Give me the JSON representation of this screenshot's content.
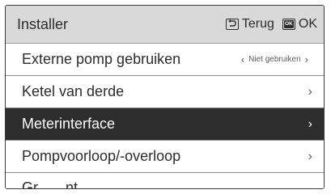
{
  "header": {
    "title": "Installer",
    "back_label": "Terug",
    "ok_key_text": "OK",
    "ok_label": "OK"
  },
  "menu": {
    "items": [
      {
        "label": "Externe pomp gebruiken",
        "value": "Niet gebruiken",
        "left_chevron": "‹",
        "right_chevron": "›"
      },
      {
        "label": "Ketel van derde",
        "right_chevron": "›"
      },
      {
        "label": "Meterinterface",
        "right_chevron": "›",
        "selected": true
      },
      {
        "label": "Pompvoorloop/-overloop",
        "right_chevron": "›"
      },
      {
        "label": "Gr... ...nt... ...."
      }
    ]
  },
  "colors": {
    "header_bg": "#d9d9d9",
    "selected_bg": "#2d2d2d",
    "text": "#2c2c2c"
  },
  "icons": {
    "back": "back-arrow-key-icon",
    "ok": "ok-key-icon"
  }
}
